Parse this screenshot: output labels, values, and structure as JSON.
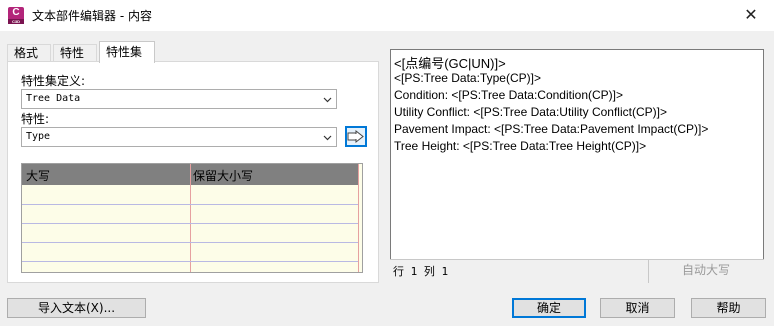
{
  "window": {
    "title": "文本部件编辑器 - 内容",
    "icon_top": "C",
    "icon_sub": "C3D",
    "close": "✕"
  },
  "tabs": [
    {
      "label": "格式",
      "active": false
    },
    {
      "label": "特性",
      "active": false
    },
    {
      "label": "特性集",
      "active": true
    }
  ],
  "property_set": {
    "definition_label": "特性集定义:",
    "definition_value": "Tree Data",
    "property_label": "特性:",
    "property_value": "Type"
  },
  "grid": {
    "headers": [
      "大写",
      "保留大小写"
    ],
    "rows": 5
  },
  "editor": {
    "lines": [
      "<[点编号(GC|UN)]>",
      "<[PS:Tree Data:Type(CP)]>",
      "Condition: <[PS:Tree Data:Condition(CP)]>",
      "Utility Conflict: <[PS:Tree Data:Utility Conflict(CP)]>",
      "Pavement Impact: <[PS:Tree Data:Pavement Impact(CP)]>",
      "Tree Height: <[PS:Tree Data:Tree Height(CP)]>"
    ],
    "status_position": "行 1 列 1",
    "auto_caps_label": "自动大写"
  },
  "buttons": {
    "import_text": "导入文本(X)...",
    "ok": "确定",
    "cancel": "取消",
    "help": "帮助"
  }
}
